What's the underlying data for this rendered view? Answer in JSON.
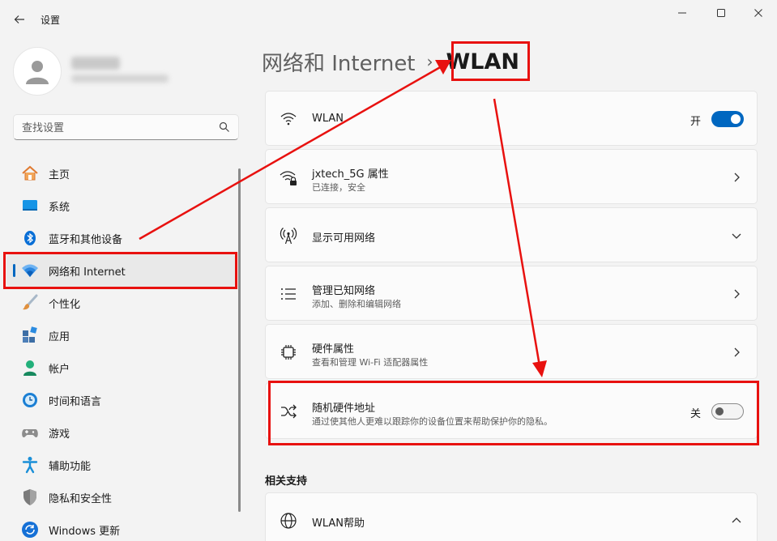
{
  "window": {
    "title": "设置",
    "back_icon": "back-arrow-icon",
    "controls": [
      "minimize-icon",
      "maximize-icon",
      "close-icon"
    ]
  },
  "search": {
    "placeholder": "查找设置"
  },
  "sidebar": {
    "items": [
      {
        "label": "主页",
        "icon": "home-icon",
        "color": "#e8863a"
      },
      {
        "label": "系统",
        "icon": "system-icon",
        "color": "#0f8ae0"
      },
      {
        "label": "蓝牙和其他设备",
        "icon": "bluetooth-icon",
        "color": "#0a6fd6"
      },
      {
        "label": "网络和 Internet",
        "icon": "wifi-icon",
        "color": "#1570d6",
        "active": true
      },
      {
        "label": "个性化",
        "icon": "brush-icon",
        "color": "#d98c3c"
      },
      {
        "label": "应用",
        "icon": "apps-icon",
        "color": "#3b6fa8"
      },
      {
        "label": "帐户",
        "icon": "account-icon",
        "color": "#1fa36e"
      },
      {
        "label": "时间和语言",
        "icon": "clock-globe-icon",
        "color": "#1b7fd4"
      },
      {
        "label": "游戏",
        "icon": "gamepad-icon",
        "color": "#7a7a7a"
      },
      {
        "label": "辅助功能",
        "icon": "accessibility-icon",
        "color": "#1a8fd8"
      },
      {
        "label": "隐私和安全性",
        "icon": "shield-icon",
        "color": "#6d6d6d"
      },
      {
        "label": "Windows 更新",
        "icon": "update-icon",
        "color": "#1570d6"
      }
    ]
  },
  "breadcrumb": {
    "parent": "网络和 Internet",
    "separator": "›",
    "current": "WLAN"
  },
  "cards": {
    "wlan": {
      "title": "WLAN",
      "state": "开",
      "toggle_on": true,
      "icon": "wifi-icon"
    },
    "network": {
      "title": "jxtech_5G 属性",
      "subtitle": "已连接，安全",
      "icon": "wifi-lock-icon"
    },
    "available": {
      "title": "显示可用网络",
      "icon": "antenna-icon"
    },
    "known": {
      "title": "管理已知网络",
      "subtitle": "添加、删除和编辑网络",
      "icon": "list-icon"
    },
    "hardware": {
      "title": "硬件属性",
      "subtitle": "查看和管理 Wi-Fi 适配器属性",
      "icon": "chip-icon"
    },
    "random_mac": {
      "title": "随机硬件地址",
      "subtitle": "通过使其他人更难以跟踪你的设备位置来帮助保护你的隐私。",
      "state": "关",
      "toggle_on": false,
      "icon": "shuffle-icon"
    }
  },
  "related": {
    "title": "相关支持",
    "help": {
      "title": "WLAN帮助",
      "icon": "globe-icon"
    }
  },
  "annotation_color": "#e8110f",
  "accent_color": "#0067c0"
}
